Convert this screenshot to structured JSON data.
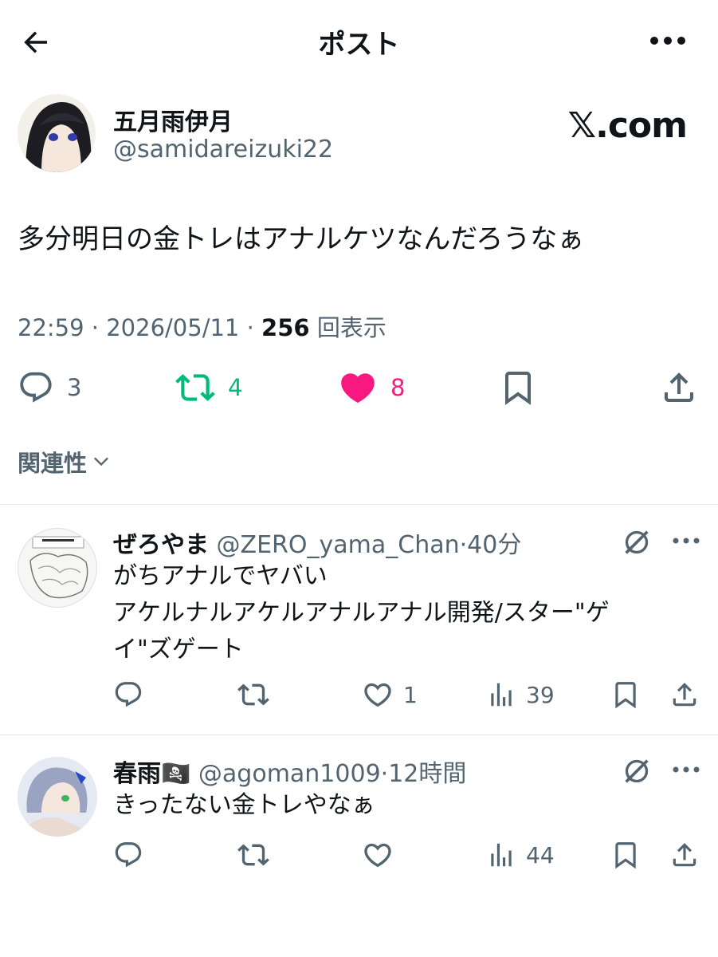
{
  "header": {
    "title": "ポスト"
  },
  "post": {
    "author_name": "五月雨伊月",
    "author_handle": "@samidareizuki22",
    "watermark": "𝕏.com",
    "text": "多分明日の金トレはアナルケツなんだろうなぁ",
    "time": "22:59",
    "date": "2026/05/11",
    "views": "256",
    "views_label": "回表示",
    "replies": "3",
    "reposts": "4",
    "likes": "8"
  },
  "sort": {
    "label": "関連性"
  },
  "replies": [
    {
      "name": "ぜろやま",
      "handle": "@ZERO_yama_Chan",
      "time": "40分",
      "lines": [
        "がちアナルでヤバい",
        "アケルナルアケルアナルアナル開発/スター\"ゲ",
        "イ\"ズゲート"
      ],
      "replies": "",
      "reposts": "",
      "likes": "1",
      "views": "39"
    },
    {
      "name": "春雨🏴‍☠️",
      "handle": "@agoman1009",
      "time": "12時間",
      "lines": [
        "きったない金トレやなぁ"
      ],
      "replies": "",
      "reposts": "",
      "likes": "",
      "views": "44"
    }
  ],
  "colors": {
    "text": "#0f1419",
    "secondary": "#536471",
    "repost": "#00ba7c",
    "like": "#f91880",
    "divider": "#e5e7ea"
  }
}
